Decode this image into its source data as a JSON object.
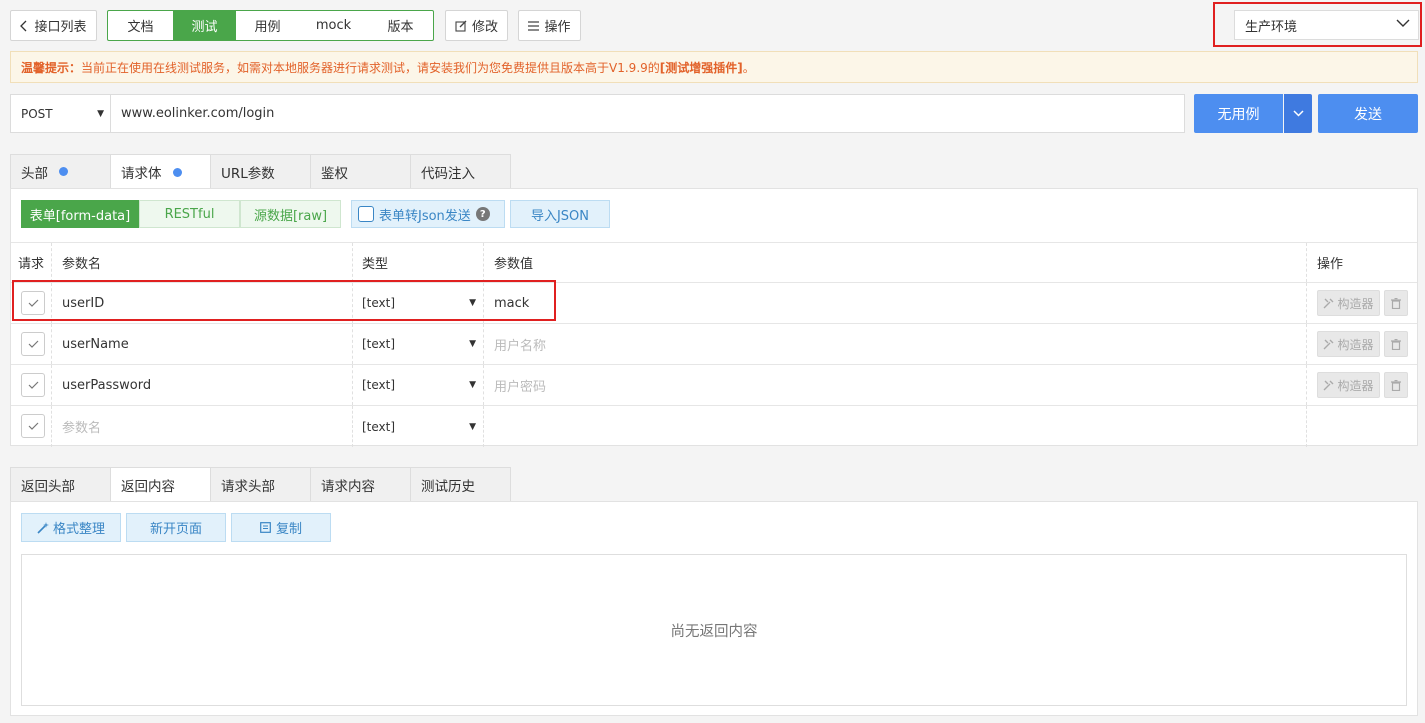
{
  "topbar": {
    "back_label": "接口列表",
    "segments": [
      {
        "label": "文档",
        "active": false
      },
      {
        "label": "测试",
        "active": true
      },
      {
        "label": "用例",
        "active": false
      },
      {
        "label": "mock",
        "active": false
      },
      {
        "label": "版本",
        "active": false
      }
    ],
    "edit_label": "修改",
    "ops_label": "操作",
    "environment": "生产环境"
  },
  "notice": {
    "prefix": "温馨提示：",
    "text": "当前正在使用在线测试服务，如需对本地服务器进行请求测试，请安装我们为您免费提供且版本高于V1.9.9的",
    "plugin": "[测试增强插件]",
    "suffix": "。"
  },
  "request": {
    "method": "POST",
    "url": "www.eolinker.com/login",
    "case_button": "无用例",
    "send_button": "发送"
  },
  "request_tabs": [
    {
      "label": "头部",
      "dot": true,
      "active": false
    },
    {
      "label": "请求体",
      "dot": true,
      "active": true
    },
    {
      "label": "URL参数",
      "dot": false,
      "active": false
    },
    {
      "label": "鉴权",
      "dot": false,
      "active": false
    },
    {
      "label": "代码注入",
      "dot": false,
      "active": false
    }
  ],
  "body_formats": {
    "form_data": "表单[form-data]",
    "restful": "RESTful",
    "raw": "源数据[raw]",
    "json_toggle": "表单转Json发送",
    "import_json": "导入JSON"
  },
  "params_table": {
    "headers": {
      "required": "请求",
      "name": "参数名",
      "type": "类型",
      "value": "参数值",
      "ops": "操作"
    },
    "rows": [
      {
        "name": "userID",
        "type": "[text]",
        "value": "mack",
        "value_placeholder": false,
        "builder": "构造器"
      },
      {
        "name": "userName",
        "type": "[text]",
        "value": "用户名称",
        "value_placeholder": true,
        "builder": "构造器"
      },
      {
        "name": "userPassword",
        "type": "[text]",
        "value": "用户密码",
        "value_placeholder": true,
        "builder": "构造器"
      }
    ],
    "new_row": {
      "name_placeholder": "参数名",
      "type": "[text]"
    }
  },
  "response_tabs": [
    {
      "label": "返回头部",
      "active": false
    },
    {
      "label": "返回内容",
      "active": true
    },
    {
      "label": "请求头部",
      "active": false
    },
    {
      "label": "请求内容",
      "active": false
    },
    {
      "label": "测试历史",
      "active": false
    }
  ],
  "response_actions": {
    "format": "格式整理",
    "new_page": "新开页面",
    "copy": "复制"
  },
  "response_empty": "尚无返回内容",
  "colors": {
    "green": "#4aa64a",
    "blue": "#4d8ef0",
    "red_highlight": "#e02020",
    "notice_text": "#e2622a"
  }
}
